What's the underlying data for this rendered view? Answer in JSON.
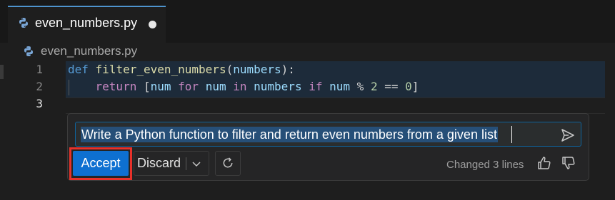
{
  "tab": {
    "filename": "even_numbers.py",
    "icon": "python-icon",
    "modified_indicator": "unsaved-dot"
  },
  "breadcrumb": {
    "filename": "even_numbers.py",
    "icon": "python-icon"
  },
  "editor": {
    "line_numbers": [
      "1",
      "2",
      "3"
    ],
    "active_line": "3",
    "lines": [
      {
        "tokens": [
          {
            "t": "kw",
            "v": "def"
          },
          {
            "t": "pun",
            "v": " "
          },
          {
            "t": "fn",
            "v": "filter_even_numbers"
          },
          {
            "t": "pun",
            "v": "("
          },
          {
            "t": "var",
            "v": "numbers"
          },
          {
            "t": "pun",
            "v": "):"
          }
        ]
      },
      {
        "tokens": [
          {
            "t": "pun",
            "v": "    "
          },
          {
            "t": "kw2",
            "v": "return"
          },
          {
            "t": "pun",
            "v": " ["
          },
          {
            "t": "var",
            "v": "num"
          },
          {
            "t": "pun",
            "v": " "
          },
          {
            "t": "kw2",
            "v": "for"
          },
          {
            "t": "pun",
            "v": " "
          },
          {
            "t": "var",
            "v": "num"
          },
          {
            "t": "pun",
            "v": " "
          },
          {
            "t": "kw2",
            "v": "in"
          },
          {
            "t": "pun",
            "v": " "
          },
          {
            "t": "var",
            "v": "numbers"
          },
          {
            "t": "pun",
            "v": " "
          },
          {
            "t": "kw2",
            "v": "if"
          },
          {
            "t": "pun",
            "v": " "
          },
          {
            "t": "var",
            "v": "num"
          },
          {
            "t": "op",
            "v": " % "
          },
          {
            "t": "num",
            "v": "2"
          },
          {
            "t": "op",
            "v": " == "
          },
          {
            "t": "num",
            "v": "0"
          },
          {
            "t": "pun",
            "v": "]"
          }
        ]
      },
      {
        "tokens": []
      }
    ]
  },
  "chat": {
    "prompt": "Write a Python function to filter and return even numbers from a given list",
    "send_icon": "send-icon",
    "accept_label": "Accept",
    "discard_label": "Discard",
    "dropdown_icon": "chevron-down-icon",
    "regenerate_icon": "refresh-icon",
    "status": "Changed 3 lines",
    "feedback": [
      "thumbs-up-icon",
      "thumbs-down-icon"
    ]
  },
  "colors": {
    "accent": "#0e70d1",
    "highlight_outline": "#e8312a",
    "keyword": "#569cd6",
    "control_keyword": "#c586c0",
    "function": "#dcdcaa",
    "variable": "#9cdcfe",
    "number": "#b5cea8"
  }
}
